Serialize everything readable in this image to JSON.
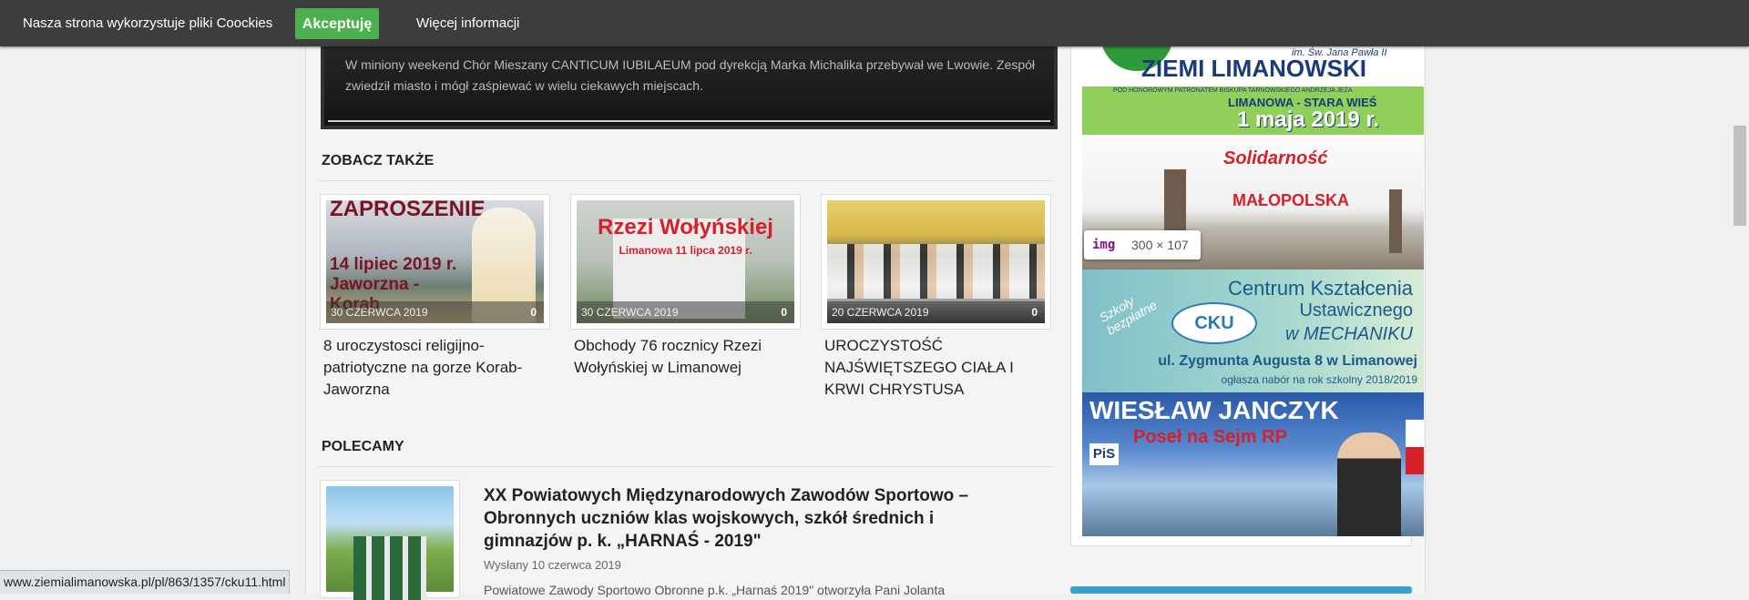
{
  "cookie": {
    "text": "Nasza strona wykorzystuje pliki Coockies",
    "accept_label": "Akceptuję",
    "more_label": "Więcej informacji"
  },
  "hero": {
    "text": "W miniony weekend Chór Mieszany CANTICUM IUBILAEUM pod dyrekcją Marka Michalika przebywał we Lwowie. Zespół zwiedził miasto i mógł zaśpiewać w wielu ciekawych miejscach."
  },
  "see_also": {
    "title": "ZOBACZ TAKŻE",
    "cards": [
      {
        "img_text": "ZAPROSZENIE",
        "img_sub": "14 lipiec 2019 r. Jaworzna - Korab",
        "date": "30 CZERWCA 2019",
        "count": "0",
        "title": "8 uroczystosci religijno-patriotyczne na gorze Korab-Jaworzna"
      },
      {
        "img_text": "Rzezi Wołyńskiej",
        "img_sub": "Limanowa 11 lipca 2019 r.",
        "date": "30 CZERWCA 2019",
        "count": "0",
        "title": "Obchody 76 rocznicy Rzezi Wołyńskiej w Limanowej"
      },
      {
        "date": "20 CZERWCA 2019",
        "count": "0",
        "title": "UROCZYSTOŚĆ NAJŚWIĘTSZEGO CIAŁA I KRWI CHRYSTUSA"
      }
    ]
  },
  "recommended": {
    "title": "POLECAMY",
    "item_title": "XX Powiatowych Międzynarodowych Zawodów Sportowo – Obronnych uczniów klas wojskowych, szkół średnich i gimnazjów p. k. „HARNAŚ - 2019\"",
    "item_date": "Wysłany 10 czerwca 2019",
    "item_excerpt": "Powiatowe Zawody Sportowo Obronne p.k. „Harnaś 2019\" otworzyła Pani Jolanta"
  },
  "sidebar": {
    "ad1": {
      "title": "ZIEMI LIMANOWSKI",
      "sub": "im. Św. Jana Pawła II",
      "patron": "POD HONOROWYM PATRONATEM BISKUPA TARNOWSKIEGO ANDRZEJA JEŻA",
      "place": "LIMANOWA - STARA WIEŚ",
      "date": "1 maja 2019 r."
    },
    "ad2": {
      "logo": "Solidarność",
      "region": "MAŁOPOLSKA"
    },
    "img_tip": {
      "tag": "img",
      "dims": "300 × 107"
    },
    "ad3": {
      "left": "Szkoły bezpłatne",
      "line1": "Centrum Kształcenia",
      "line2": "Ustawicznego",
      "line3": "w MECHANIKU",
      "logo": "CKU",
      "address": "ul. Zygmunta Augusta 8 w Limanowej",
      "notice": "ogłasza nabór na rok szkolny 2018/2019"
    },
    "ad4": {
      "name": "WIESŁAW JANCZYK",
      "role": "Poseł na Sejm RP",
      "party": "PiS"
    }
  },
  "status_url": "www.ziemialimanowska.pl/pl/863/1357/cku11.html"
}
